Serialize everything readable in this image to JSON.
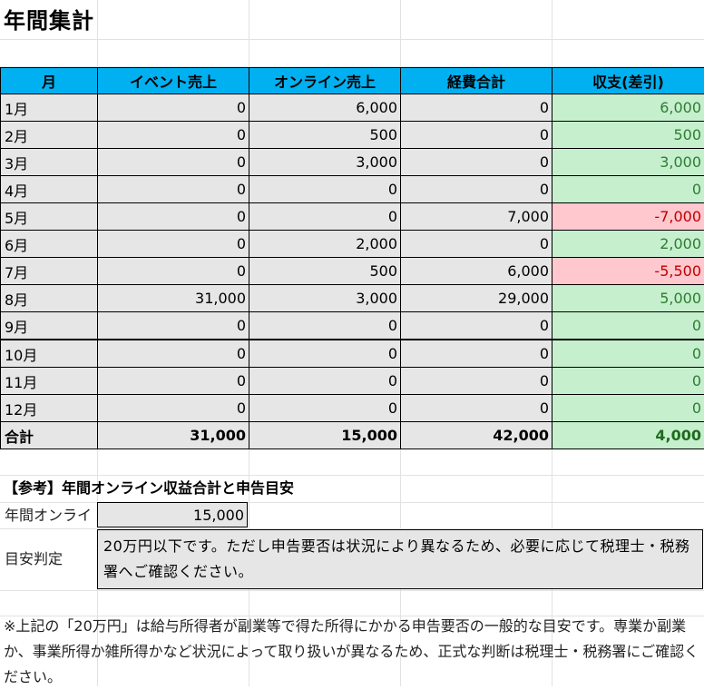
{
  "title": "年間集計",
  "table": {
    "headers": [
      "月",
      "イベント売上",
      "オンライン売上",
      "経費合計",
      "収支(差引)"
    ],
    "rows": [
      {
        "month": "1月",
        "event": "0",
        "online": "6,000",
        "expense": "0",
        "balance": "6,000",
        "sign": "pos"
      },
      {
        "month": "2月",
        "event": "0",
        "online": "500",
        "expense": "0",
        "balance": "500",
        "sign": "pos"
      },
      {
        "month": "3月",
        "event": "0",
        "online": "3,000",
        "expense": "0",
        "balance": "3,000",
        "sign": "pos"
      },
      {
        "month": "4月",
        "event": "0",
        "online": "0",
        "expense": "0",
        "balance": "0",
        "sign": "pos"
      },
      {
        "month": "5月",
        "event": "0",
        "online": "0",
        "expense": "7,000",
        "balance": "-7,000",
        "sign": "neg"
      },
      {
        "month": "6月",
        "event": "0",
        "online": "2,000",
        "expense": "0",
        "balance": "2,000",
        "sign": "pos"
      },
      {
        "month": "7月",
        "event": "0",
        "online": "500",
        "expense": "6,000",
        "balance": "-5,500",
        "sign": "neg"
      },
      {
        "month": "8月",
        "event": "31,000",
        "online": "3,000",
        "expense": "29,000",
        "balance": "5,000",
        "sign": "pos"
      },
      {
        "month": "9月",
        "event": "0",
        "online": "0",
        "expense": "0",
        "balance": "0",
        "sign": "pos"
      },
      {
        "month": "10月",
        "event": "0",
        "online": "0",
        "expense": "0",
        "balance": "0",
        "sign": "pos"
      },
      {
        "month": "11月",
        "event": "0",
        "online": "0",
        "expense": "0",
        "balance": "0",
        "sign": "pos"
      },
      {
        "month": "12月",
        "event": "0",
        "online": "0",
        "expense": "0",
        "balance": "0",
        "sign": "pos"
      }
    ],
    "total": {
      "label": "合計",
      "event": "31,000",
      "online": "15,000",
      "expense": "42,000",
      "balance": "4,000"
    }
  },
  "reference": {
    "heading": "【参考】年間オンライン収益合計と申告目安",
    "online_label": "年間オンライ",
    "online_value": "15,000",
    "judge_label": "目安判定",
    "judge_text": "20万円以下です。ただし申告要否は状況により異なるため、必要に応じて税理士・税務署へご確認ください。"
  },
  "note": "※上記の「20万円」は給与所得者が副業等で得た所得にかかる申告要否の一般的な目安です。専業か副業か、事業所得か雑所得かなど状況によって取り扱いが異なるため、正式な判断は税理士・税務署にご確認ください。",
  "colors": {
    "header_bg": "#00b0f0",
    "cell_bg": "#e6e6e6",
    "positive_bg": "#c6efce",
    "negative_bg": "#ffc7ce",
    "positive_text": "#2e7d32",
    "negative_text": "#c00000"
  }
}
